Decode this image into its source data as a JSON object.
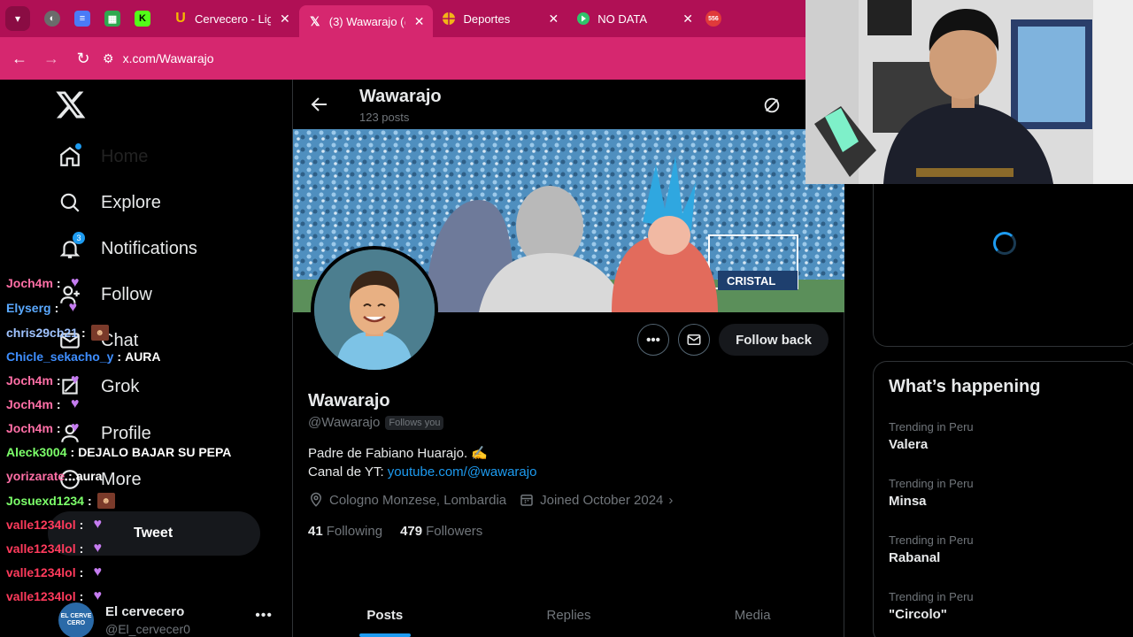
{
  "browser": {
    "tabs": [
      {
        "title": "",
        "favicon": "globe-icon",
        "color": "#6b6b6b",
        "pinned": true
      },
      {
        "title": "",
        "favicon": "docs-icon",
        "color": "#4a7bf7",
        "pinned": true
      },
      {
        "title": "",
        "favicon": "sheets-icon",
        "color": "#2fa84f",
        "pinned": true
      },
      {
        "title": "",
        "favicon": "kick-icon",
        "color": "#53fc18",
        "pinned": true,
        "letter": "K"
      },
      {
        "title": "Cervecero - Lig",
        "favicon": "u-icon",
        "color": "#f5b800",
        "letter": "U"
      },
      {
        "title": "(3) Wawarajo (@",
        "favicon": "x-icon",
        "color": "#000000",
        "letter": "𝕏",
        "active": true
      },
      {
        "title": "Deportes",
        "favicon": "deportes-icon",
        "color": "#f2b418"
      },
      {
        "title": "NO DATA",
        "favicon": "play-icon",
        "color": "#2fc46b"
      }
    ],
    "url": "x.com/Wawarajo"
  },
  "nav": {
    "items": [
      {
        "key": "home",
        "label": "Home",
        "icon": "home-icon"
      },
      {
        "key": "explore",
        "label": "Explore",
        "icon": "search-icon"
      },
      {
        "key": "notifications",
        "label": "Notifications",
        "icon": "bell-icon",
        "badge": "3"
      },
      {
        "key": "follow",
        "label": "Follow",
        "icon": "person-plus-icon"
      },
      {
        "key": "chat",
        "label": "Chat",
        "icon": "mail-icon"
      },
      {
        "key": "grok",
        "label": "Grok",
        "icon": "grok-icon"
      },
      {
        "key": "profile",
        "label": "Profile",
        "icon": "person-icon"
      },
      {
        "key": "more",
        "label": "More",
        "icon": "more-circle-icon"
      }
    ],
    "tweet_label": "Tweet",
    "account": {
      "name": "El cervecero",
      "handle": "@El_cervecer0",
      "avatar_text": "EL CERVE CERO"
    }
  },
  "chat": {
    "lines": [
      {
        "user": "Joch4m",
        "color": "#ff6fa6",
        "msg": "",
        "emote": "heart"
      },
      {
        "user": "Elyserg",
        "color": "#5aa9ff",
        "msg": "",
        "emote": "heart"
      },
      {
        "user": "chris29cb21",
        "color": "#9fc3ff",
        "msg": "",
        "emote": "face"
      },
      {
        "user": "Chicle_sekacho_y",
        "color": "#3e8eff",
        "msg": "AURA",
        "emote": ""
      },
      {
        "user": "Joch4m",
        "color": "#ff6fa6",
        "msg": "",
        "emote": "heart"
      },
      {
        "user": "Joch4m",
        "color": "#ff6fa6",
        "msg": "",
        "emote": "heart"
      },
      {
        "user": "Joch4m",
        "color": "#ff6fa6",
        "msg": "",
        "emote": "heart"
      },
      {
        "user": "Aleck3004",
        "color": "#7cff6a",
        "msg": "DEJALO BAJAR SU PEPA",
        "emote": ""
      },
      {
        "user": "yorizarate",
        "color": "#ff6fa6",
        "msg": "aura",
        "emote": ""
      },
      {
        "user": "Josuexd1234",
        "color": "#7cff6a",
        "msg": "",
        "emote": "face"
      },
      {
        "user": "valle1234lol",
        "color": "#ff3b5c",
        "msg": "",
        "emote": "heart"
      },
      {
        "user": "valle1234lol",
        "color": "#ff3b5c",
        "msg": "",
        "emote": "heart"
      },
      {
        "user": "valle1234lol",
        "color": "#ff3b5c",
        "msg": "",
        "emote": "heart"
      },
      {
        "user": "valle1234lol",
        "color": "#ff3b5c",
        "msg": "",
        "emote": "heart"
      }
    ]
  },
  "profile": {
    "header_name": "Wawarajo",
    "header_posts": "123 posts",
    "name": "Wawarajo",
    "handle": "@Wawarajo",
    "follows_you": "Follows you",
    "bio_line1": "Padre de Fabiano Huarajo. ✍️",
    "bio_line2_prefix": "Canal de YT: ",
    "bio_link": "youtube.com/@wawarajo",
    "location": "Cologno Monzese, Lombardia",
    "joined": "Joined October 2024",
    "following_count": "41",
    "following_label": "Following",
    "followers_count": "479",
    "followers_label": "Followers",
    "follow_back_label": "Follow back",
    "banner_sponsor": "CRISTAL",
    "tabs": [
      "Posts",
      "Replies",
      "Media"
    ]
  },
  "trends": {
    "title": "What’s happening",
    "items": [
      {
        "context": "Trending in Peru",
        "name": "Valera"
      },
      {
        "context": "Trending in Peru",
        "name": "Minsa"
      },
      {
        "context": "Trending in Peru",
        "name": "Rabanal"
      },
      {
        "context": "Trending in Peru",
        "name": "\"Circolo\""
      }
    ]
  },
  "colors": {
    "accent": "#1d9bf0",
    "tab_bar": "#b01055",
    "address_bar": "#d6276f"
  }
}
